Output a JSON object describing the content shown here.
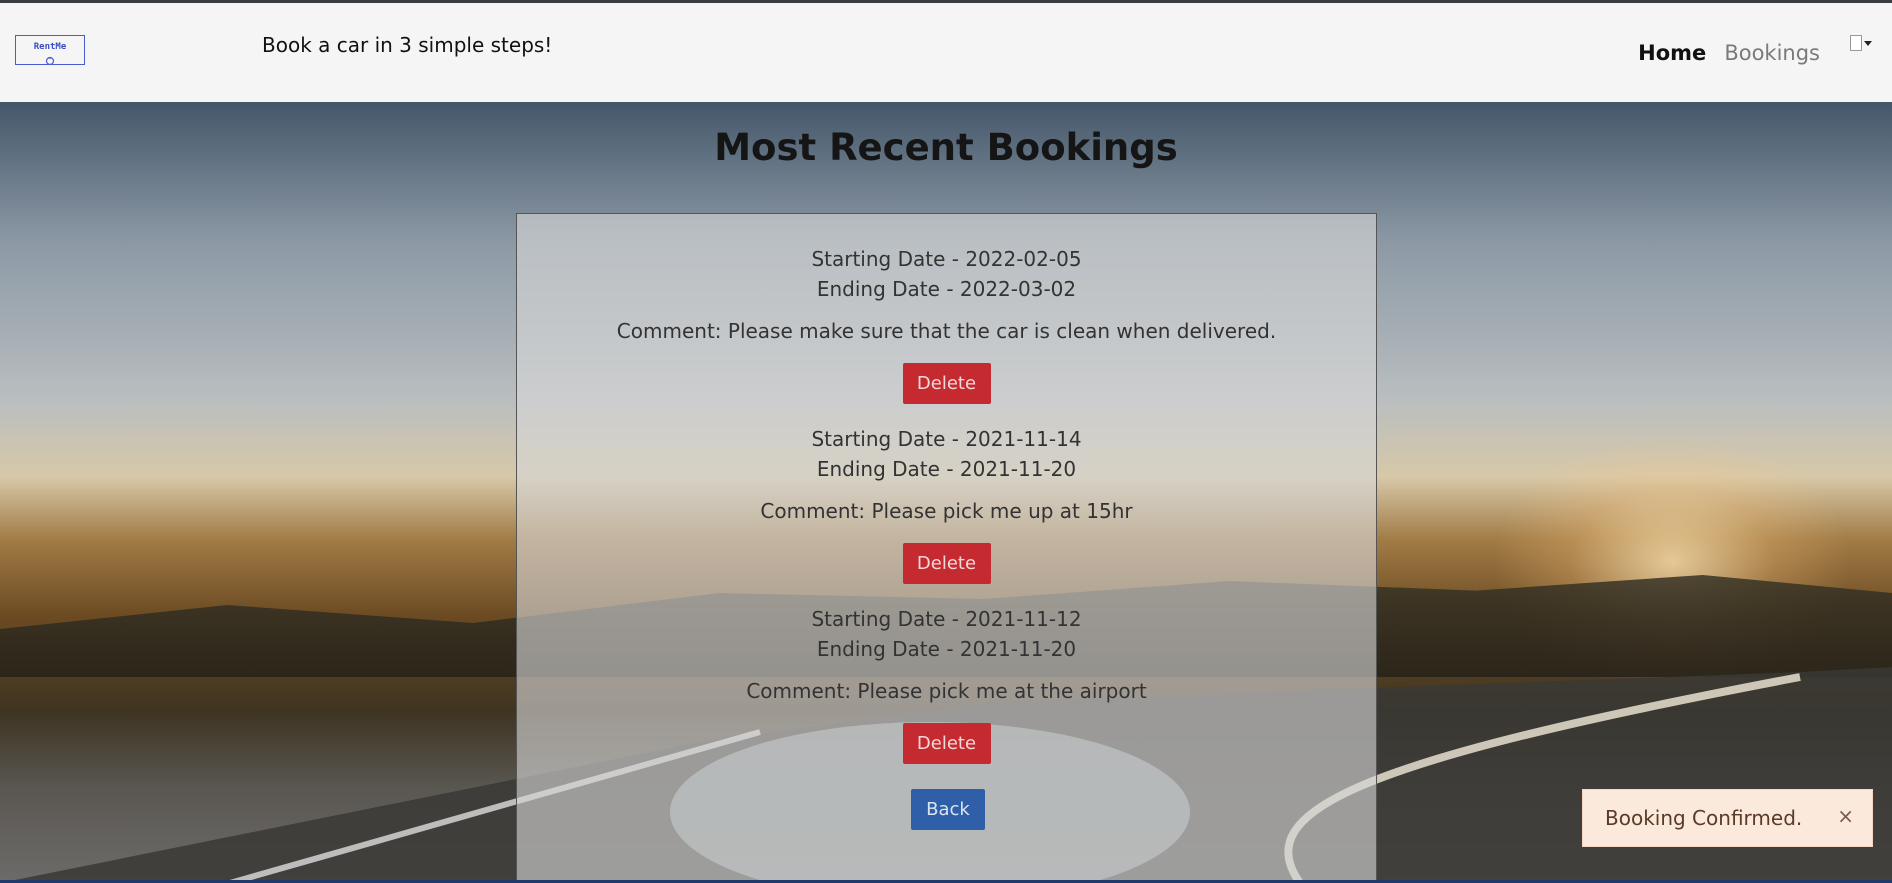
{
  "header": {
    "logo_text": "RentMe",
    "tagline": "Book a car in 3 simple steps!",
    "nav": {
      "home": "Home",
      "bookings": "Bookings"
    }
  },
  "main": {
    "title": "Most Recent Bookings",
    "bookings": [
      {
        "start": "Starting Date - 2022-02-05",
        "end": "Ending Date - 2022-03-02",
        "comment": "Comment: Please make sure that the car is clean when delivered.",
        "delete_label": "Delete"
      },
      {
        "start": "Starting Date - 2021-11-14",
        "end": "Ending Date - 2021-11-20",
        "comment": "Comment: Please pick me up at 15hr",
        "delete_label": "Delete"
      },
      {
        "start": "Starting Date - 2021-11-12",
        "end": "Ending Date - 2021-11-20",
        "comment": "Comment: Please pick me at the airport",
        "delete_label": "Delete"
      }
    ],
    "back_label": "Back"
  },
  "toast": {
    "message": "Booking Confirmed.",
    "close_symbol": "×"
  },
  "colors": {
    "delete_button": "#c52a30",
    "back_button": "#2f5fa8",
    "toast_bg": "#fbe9dc"
  },
  "icons": {
    "avatar": "broken-image-avatar-icon",
    "dropdown": "caret-down-icon"
  }
}
